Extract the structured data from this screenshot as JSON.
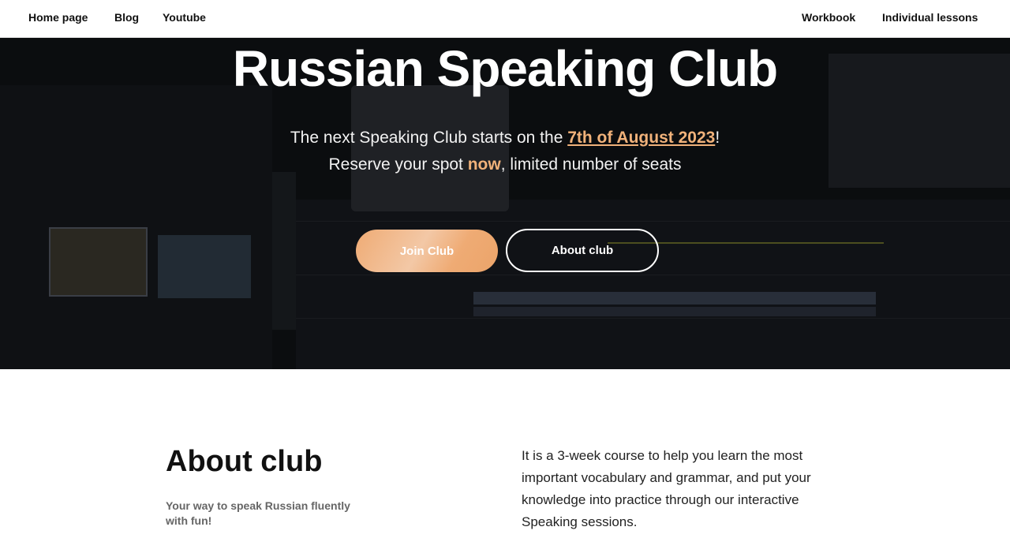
{
  "nav": {
    "home": "Home page",
    "blog": "Blog",
    "youtube": "Youtube",
    "workbook": "Workbook",
    "lessons": "Individual lessons"
  },
  "hero": {
    "title": "Russian Speaking Club",
    "line1_prefix": "The next Speaking Club starts on the ",
    "line1_date": "7th of August 2023",
    "line1_suffix": "!",
    "line2_prefix": "Reserve your spot ",
    "line2_emph": "now",
    "line2_suffix": ", limited number of seats",
    "join_button": "Join Club",
    "about_button": "About club"
  },
  "about": {
    "title": "About club",
    "tagline": "Your way to speak Russian fluently with fun!",
    "description": "It is a 3-week course to help you learn the most important vocabulary and grammar, and put your knowledge into practice through our interactive Speaking sessions."
  },
  "colors": {
    "accent": "#efab74",
    "hero_bg": "#15181d"
  }
}
